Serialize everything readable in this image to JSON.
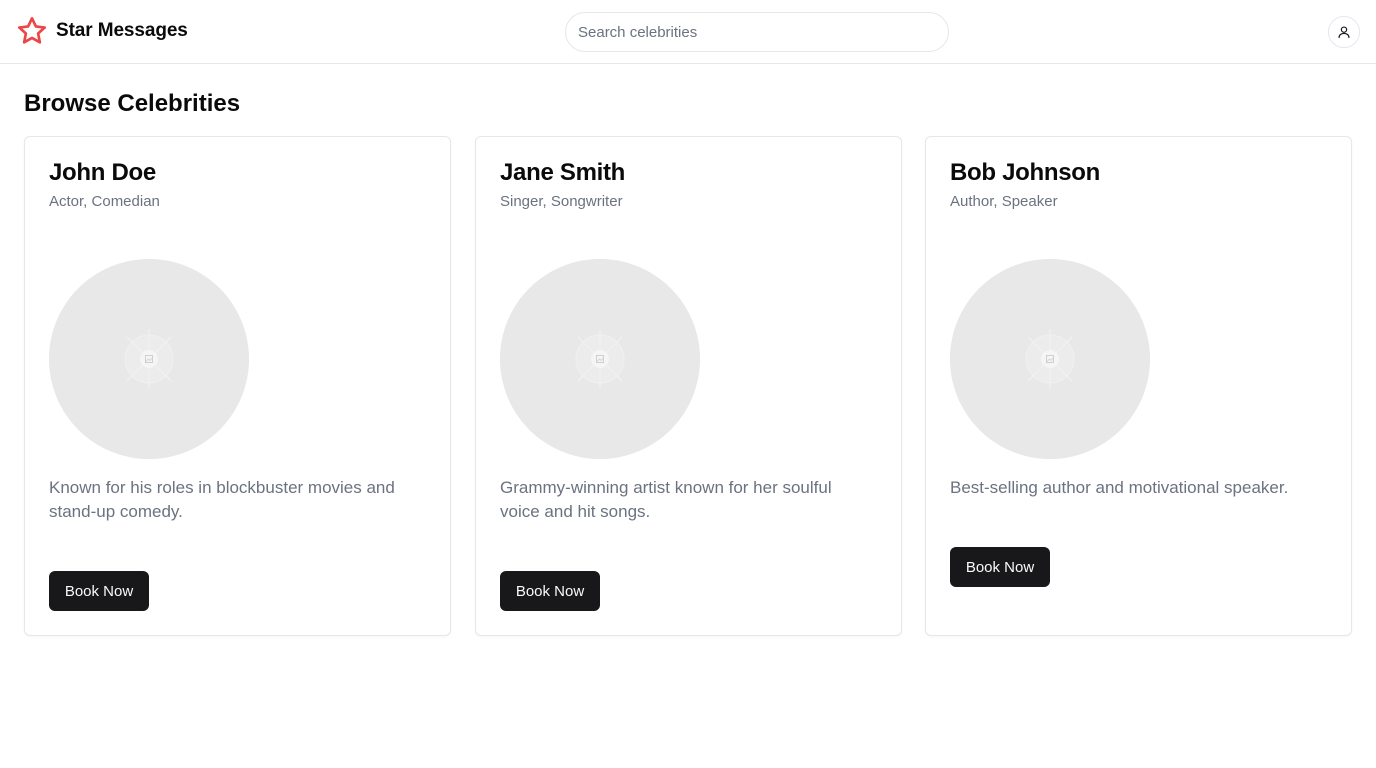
{
  "app": {
    "title": "Star Messages",
    "brand_color": "#ef4444"
  },
  "search": {
    "placeholder": "Search celebrities",
    "value": ""
  },
  "header": {
    "user_icon": "user-icon"
  },
  "page": {
    "title": "Browse Celebrities"
  },
  "celebrities": [
    {
      "name": "John Doe",
      "role": "Actor, Comedian",
      "description": "Known for his roles in blockbuster movies and stand-up comedy.",
      "button_label": "Book Now"
    },
    {
      "name": "Jane Smith",
      "role": "Singer, Songwriter",
      "description": "Grammy-winning artist known for her soulful voice and hit songs.",
      "button_label": "Book Now"
    },
    {
      "name": "Bob Johnson",
      "role": "Author, Speaker",
      "description": "Best-selling author and motivational speaker.",
      "button_label": "Book Now"
    }
  ]
}
